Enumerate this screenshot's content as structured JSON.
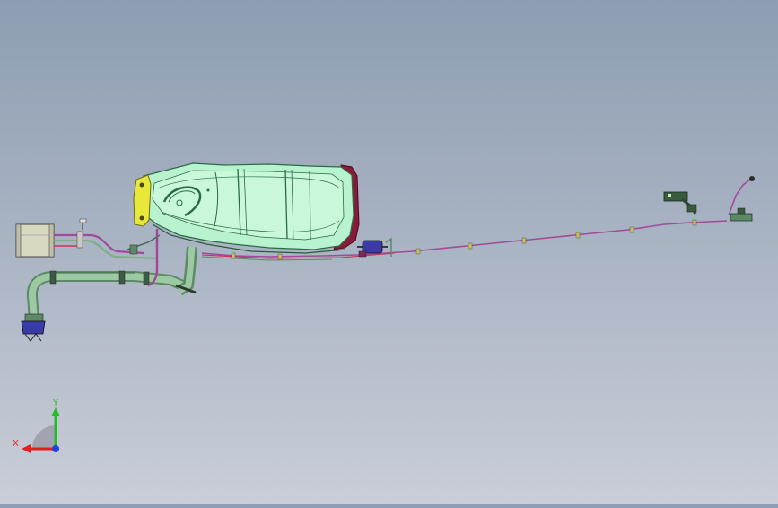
{
  "viewport": {
    "description_hidden": "",
    "triad": {
      "x_label": "X",
      "y_label": "Y",
      "x_color": "#e02020",
      "y_color": "#20c020",
      "z_color": "#2040e0"
    }
  },
  "colors": {
    "tank_fill": "#b9f2cf",
    "tank_stroke": "#2a6b45",
    "strap_yellow": "#e8e83a",
    "flange_red": "#8a1a3a",
    "pipe_green": "#7fae86",
    "line_purple": "#a04a9a",
    "canister_fill": "#d9d9c2",
    "filter_blue": "#3a3aa8"
  }
}
